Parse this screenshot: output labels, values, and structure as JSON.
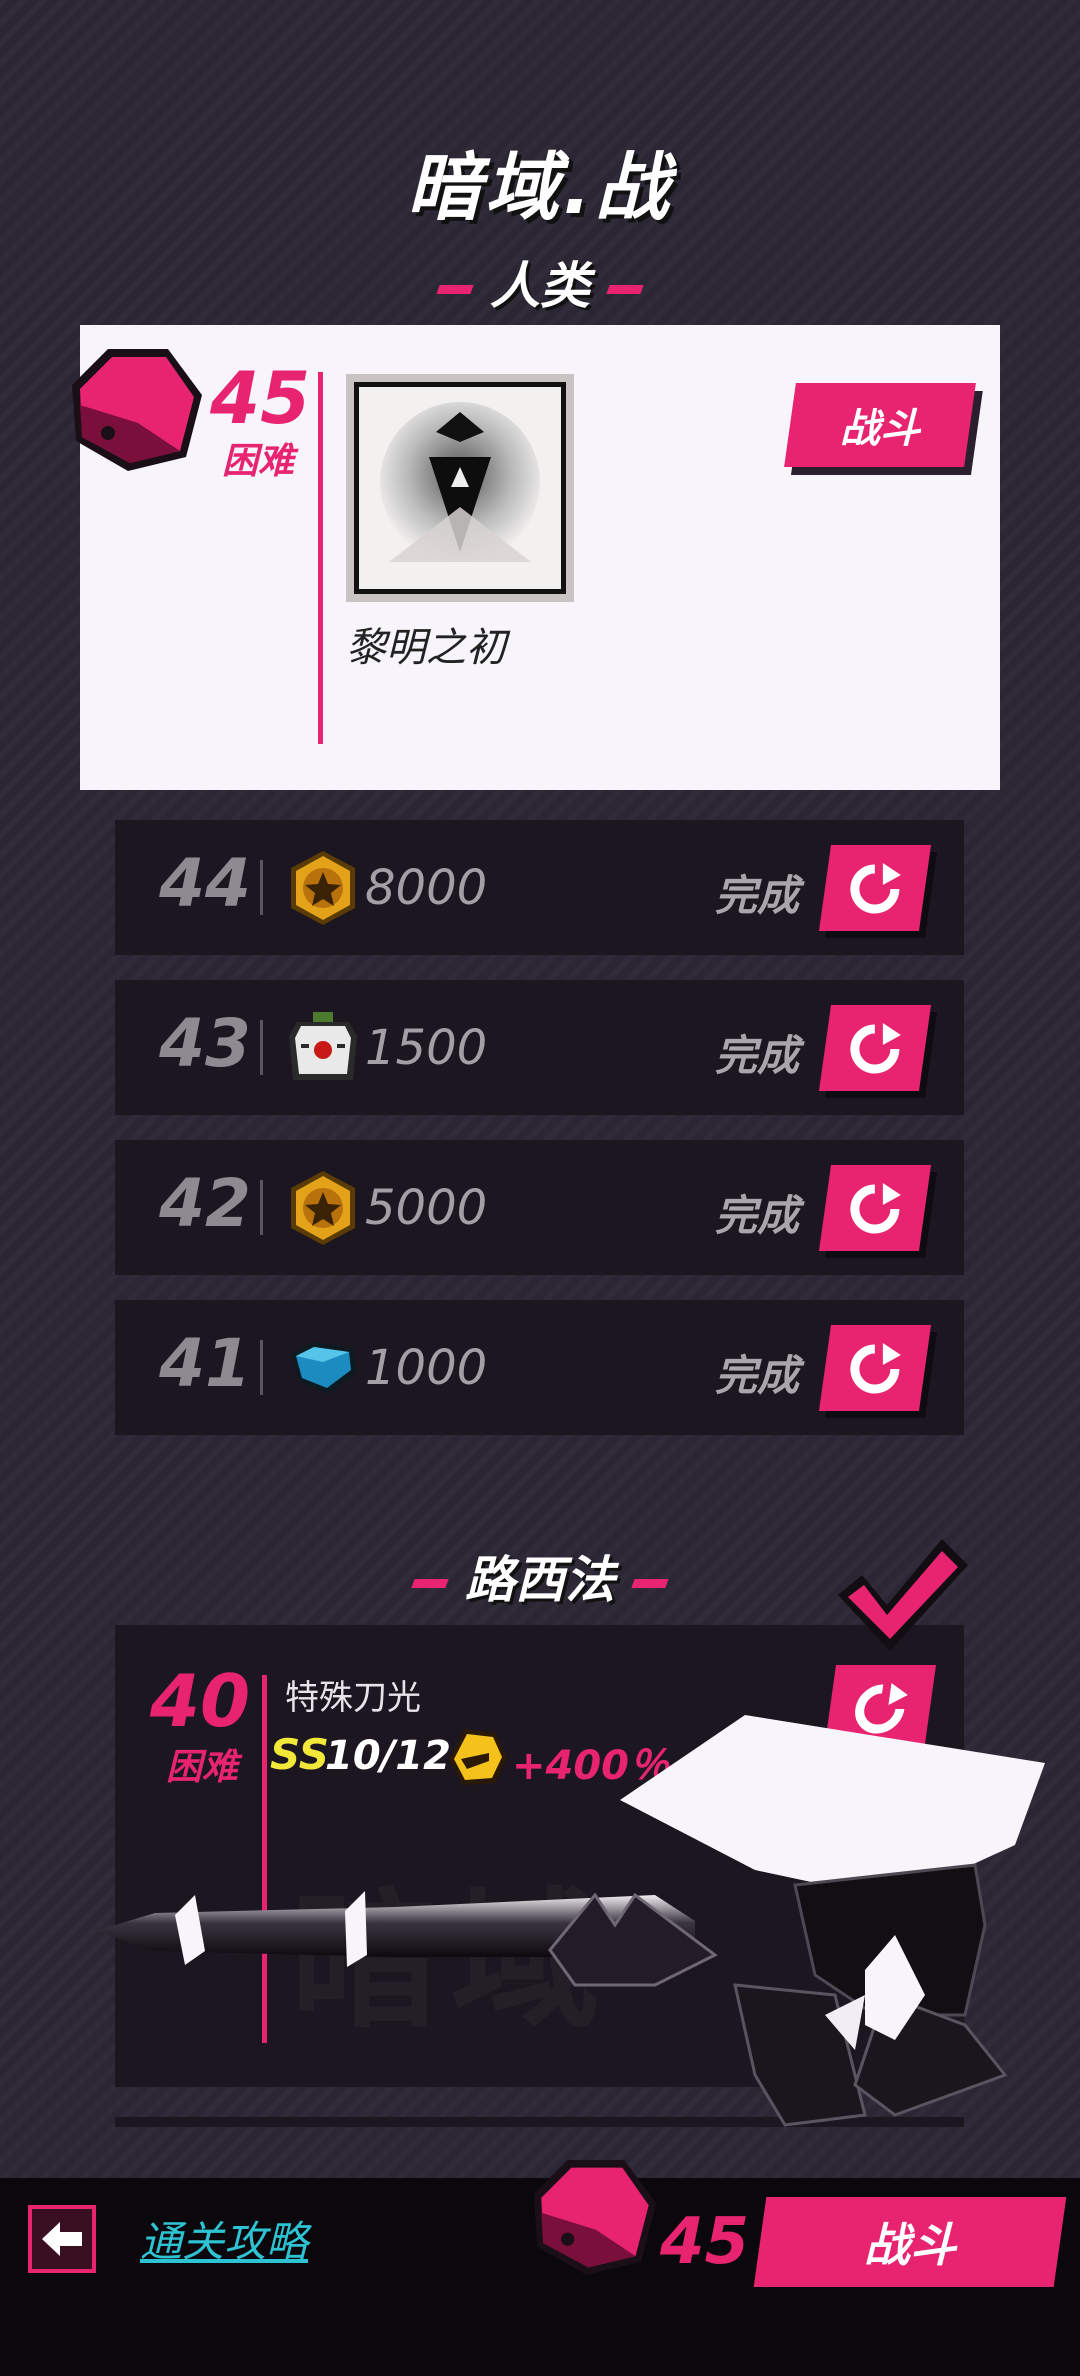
{
  "header": {
    "title": "暗域.战"
  },
  "sections": {
    "human": "人类",
    "lucifer": "路西法"
  },
  "current_stage": {
    "level": "45",
    "difficulty": "困难",
    "name": "黎明之初",
    "fight_label": "战斗"
  },
  "completed": [
    {
      "level": "44",
      "reward_icon": "gold-coin-icon",
      "amount": "8000",
      "status": "完成"
    },
    {
      "level": "43",
      "reward_icon": "robot-chip-icon",
      "amount": "1500",
      "status": "完成"
    },
    {
      "level": "42",
      "reward_icon": "gold-coin-icon",
      "amount": "5000",
      "status": "完成"
    },
    {
      "level": "41",
      "reward_icon": "blue-gem-icon",
      "amount": "1000",
      "status": "完成"
    }
  ],
  "boss_stage": {
    "level": "40",
    "difficulty": "困难",
    "skill": "特殊刀光",
    "grade": "SS",
    "count": "10/12",
    "bonus": "+400％",
    "watermark": "暗域"
  },
  "footer": {
    "guide_label": "通关攻略",
    "level": "45",
    "fight_label": "战斗"
  },
  "colors": {
    "accent": "#e8236f",
    "link": "#2ec3d3",
    "card": "#1c1620"
  }
}
